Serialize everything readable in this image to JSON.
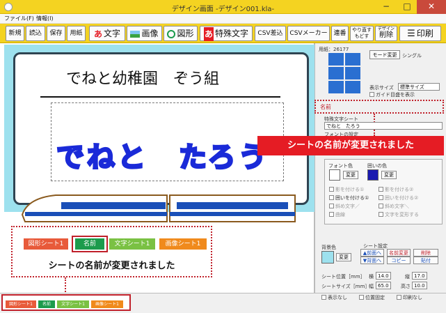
{
  "window": {
    "title": "デザイン画面 -デザイン001.kla-",
    "minimize": "−",
    "maximize": "□",
    "close": "✕"
  },
  "menu": [
    {
      "label": "ファイル(F)"
    },
    {
      "label": "情報(I)"
    }
  ],
  "toolbar": {
    "new": "新規",
    "open": "読込",
    "save": "保存",
    "paper": "用紙",
    "text": "文字",
    "text_icon": "あ",
    "image": "画像",
    "shape": "図形",
    "special_text": "特殊文字",
    "special_icon": "あ",
    "csv_merge": "CSV差込",
    "csv_maker": "CSVメーカー",
    "serial": "連番",
    "redo": "やり直す",
    "undo": "もどす",
    "design_delete_small": "デザイン",
    "design_delete": "削除",
    "print": "印刷"
  },
  "design": {
    "header_text": "でねと幼稚園　ぞう組",
    "name_text": "でねと　たろう"
  },
  "callout": {
    "text": "シートの名前が変更されました"
  },
  "overlay": {
    "tabs": [
      {
        "label": "図形シート1",
        "color": "#e85a3a"
      },
      {
        "label": "名前",
        "color": "#1c9b4c"
      },
      {
        "label": "文字シート1",
        "color": "#7ac143"
      },
      {
        "label": "画像シート1",
        "color": "#f08a1c"
      }
    ],
    "message": "シートの名前が変更されました"
  },
  "bottom_tabs": [
    {
      "label": "図形シート1",
      "color": "#e85a3a"
    },
    {
      "label": "名前",
      "color": "#1c9b4c"
    },
    {
      "label": "文字シート1",
      "color": "#7ac143"
    },
    {
      "label": "画像シート1",
      "color": "#f08a1c"
    }
  ],
  "right_panel": {
    "paper_label": "用紙：26177",
    "mode_button": "モード変更",
    "mode_value": "シングル",
    "display_size_label": "表示サイズ",
    "display_size_value": "標準サイズ",
    "guide_check": "ガイド目盛を表示",
    "sheet_name_label": "名前",
    "special_text_label": "特殊文字シート",
    "special_text_value": "でねと　たろう",
    "font_setting": "フォントの設定",
    "font_color": "フォント色",
    "fill_color": "囲いの色",
    "change": "変更",
    "shadow_left": "影を付ける①",
    "shadow_right": "影を付ける②",
    "surround_left": "囲いを付ける①",
    "surround_right": "囲いを付ける②",
    "italic_left": "斜め文字／",
    "italic_right": "斜め文字＼",
    "curve": "曲線",
    "outline": "文字を変形する",
    "bg_color": "背景色",
    "sheet_setting": "シート設定",
    "front": "▲前面へ",
    "back": "▼背面へ",
    "rename": "名前変更",
    "copy": "コピー",
    "delete": "削除",
    "paste": "貼付",
    "pos_label": "シート位置［mm］",
    "pos_x_label": "横",
    "pos_x": "14.0",
    "pos_y_label": "縦",
    "pos_y": "17.0",
    "size_label": "シートサイズ［mm］",
    "width_label": "幅",
    "width": "65.0",
    "height_label": "高さ",
    "height": "10.0",
    "hide": "表示なし",
    "lock": "位置固定",
    "noprint": "印刷なし"
  }
}
